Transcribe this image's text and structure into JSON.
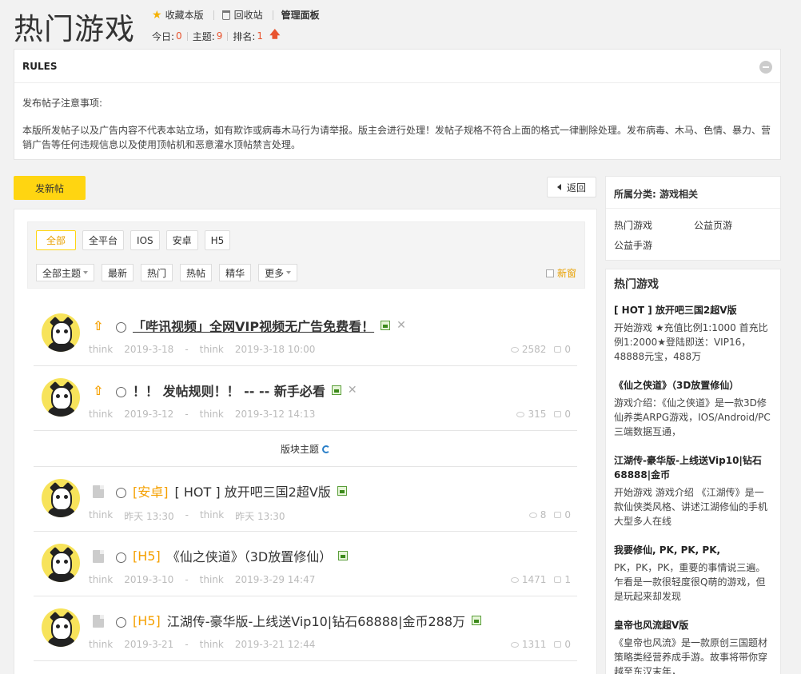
{
  "header": {
    "title": "热门游戏",
    "favorite": "收藏本版",
    "recycle": "回收站",
    "admin": "管理面板",
    "today_label": "今日:",
    "today_value": "0",
    "topics_label": "主题:",
    "topics_value": "9",
    "rank_label": "排名:",
    "rank_value": "1"
  },
  "rules": {
    "heading": "RULES",
    "line1": "发布帖子注意事项:",
    "line2": "本版所发帖子以及广告内容不代表本站立场，如有欺诈或病毒木马行为请举报。版主会进行处理！发帖子规格不符合上面的格式一律删除处理。发布病毒、木马、色情、暴力、营销广告等任何违规信息以及使用顶帖机和恶意灌水顶帖禁言处理。"
  },
  "toolbar": {
    "post_label": "发新帖",
    "back_label": "返回"
  },
  "filters": {
    "platforms": [
      "全部",
      "全平台",
      "IOS",
      "安卓",
      "H5"
    ],
    "sorts": [
      "全部主题",
      "最新",
      "热门",
      "热帖",
      "精华",
      "更多"
    ],
    "new_window": "新窗"
  },
  "section_label": "版块主题",
  "threads": [
    {
      "cat": "",
      "title": "「哔讯视频」全网VIP视频无广告免费看！",
      "author": "think",
      "date": "2019-3-18",
      "last_author": "think",
      "last_date": "2019-3-18 10:00",
      "views": "2582",
      "replies": "0"
    },
    {
      "cat": "",
      "title": "！！ 发帖规则！！ -- -- 新手必看",
      "author": "think",
      "date": "2019-3-12",
      "last_author": "think",
      "last_date": "2019-3-12 14:13",
      "views": "315",
      "replies": "0"
    },
    {
      "cat": "[安卓]",
      "title": "[ HOT ] 放开吧三国2超V版",
      "author": "think",
      "date": "昨天 13:30",
      "last_author": "think",
      "last_date": "昨天 13:30",
      "views": "8",
      "replies": "0"
    },
    {
      "cat": "[H5]",
      "title": "《仙之侠道》（3D放置修仙）",
      "author": "think",
      "date": "2019-3-10",
      "last_author": "think",
      "last_date": "2019-3-29 14:47",
      "views": "1471",
      "replies": "1"
    },
    {
      "cat": "[H5]",
      "title": "江湖传-豪华版-上线送Vip10|钻石68888|金币288万",
      "author": "think",
      "date": "2019-3-21",
      "last_author": "think",
      "last_date": "2019-3-21 12:44",
      "views": "1311",
      "replies": "0"
    }
  ],
  "meta_sep": "-",
  "sidebar": {
    "category_heading": "所属分类: 游戏相关",
    "links": [
      "热门游戏",
      "公益页游",
      "公益手游"
    ],
    "hot_heading": "热门游戏",
    "hot": [
      {
        "title": "[ HOT ] 放开吧三国2超V版",
        "desc": "开始游戏 ★充值比例1:1000 首充比例1:2000★登陆即送：VIP16，48888元宝，488万"
      },
      {
        "title": "《仙之侠道》（3D放置修仙）",
        "desc": "游戏介绍：《仙之侠道》是一款3D修仙养类ARPG游戏，IOS/Android/PC三端数据互通，"
      },
      {
        "title": "江湖传-豪华版-上线送Vip10|钻石68888|金币",
        "desc": "开始游戏 游戏介绍 《江湖传》是一款仙侠类风格、讲述江湖修仙的手机大型多人在线"
      },
      {
        "title": "我要修仙, PK, PK, PK,",
        "desc": "PK，PK，PK，重要的事情说三遍。乍看是一款很轻度很Q萌的游戏，但是玩起来却发现"
      },
      {
        "title": "皇帝也风流超V版",
        "desc": "《皇帝也风流》是一款原创三国题材策略类经营养成手游。故事将带你穿越至东汉末年，"
      }
    ]
  },
  "colors": {
    "accent": "#ffd511",
    "orange": "#f5a000",
    "red": "#e8542f"
  }
}
